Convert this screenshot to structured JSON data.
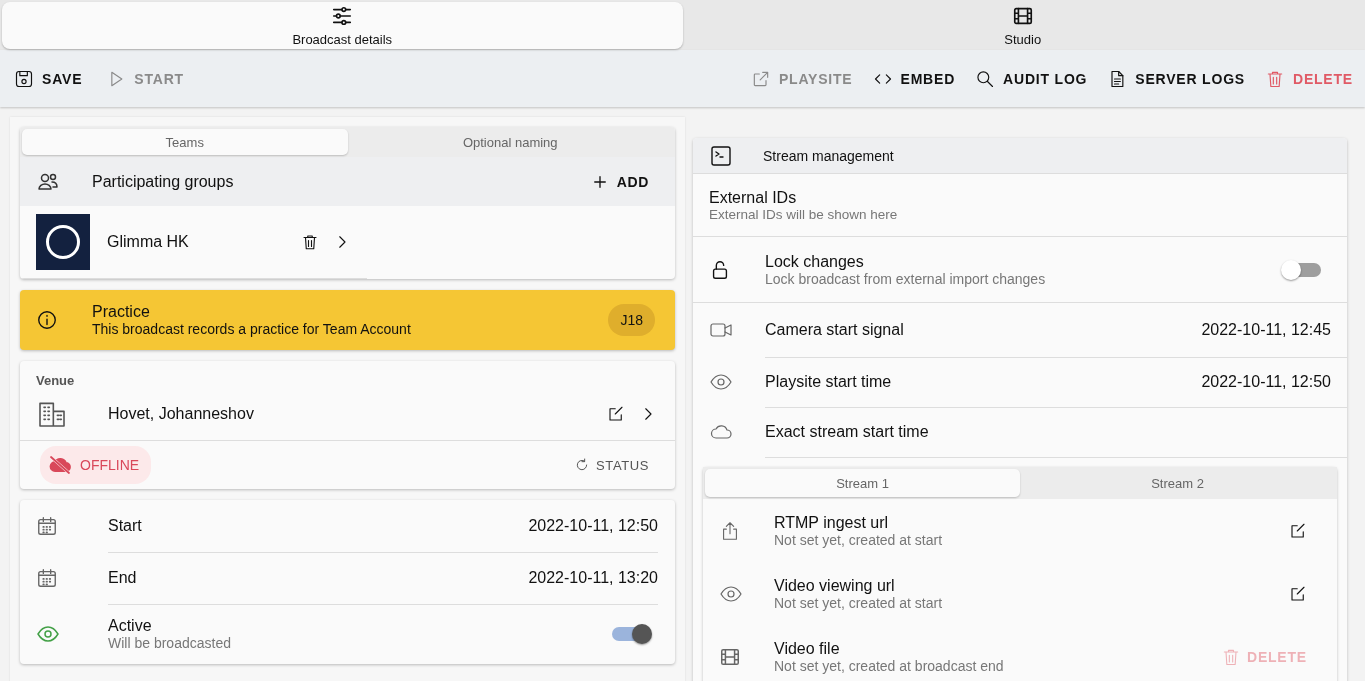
{
  "top_tabs": [
    {
      "label": "Broadcast details",
      "selected": true
    },
    {
      "label": "Studio",
      "selected": false
    }
  ],
  "toolbar": {
    "left": [
      {
        "label": "SAVE",
        "disabled": false
      },
      {
        "label": "START",
        "disabled": true
      }
    ],
    "right": [
      {
        "label": "PLAYSITE",
        "disabled": true,
        "kind": "normal"
      },
      {
        "label": "EMBED",
        "disabled": false,
        "kind": "normal"
      },
      {
        "label": "AUDIT LOG",
        "disabled": false,
        "kind": "normal"
      },
      {
        "label": "SERVER LOGS",
        "disabled": false,
        "kind": "normal"
      },
      {
        "label": "DELETE",
        "disabled": false,
        "kind": "danger"
      }
    ]
  },
  "teams_card": {
    "tabs": [
      {
        "label": "Teams",
        "selected": true
      },
      {
        "label": "Optional naming",
        "selected": false
      }
    ],
    "header": {
      "title": "Participating groups",
      "action": "ADD"
    },
    "groups": [
      {
        "name": "Glimma HK"
      }
    ]
  },
  "practice": {
    "title": "Practice",
    "text": "This broadcast records a practice for Team Account",
    "badge": "J18"
  },
  "venue": {
    "label": "Venue",
    "name": "Hovet, Johanneshov",
    "status": "OFFLINE",
    "status_action": "STATUS"
  },
  "schedule": [
    {
      "kind": "time",
      "label": "Start",
      "value": "2022-10-11, 12:50"
    },
    {
      "kind": "time",
      "label": "End",
      "value": "2022-10-11, 13:20"
    },
    {
      "kind": "toggle",
      "label": "Active",
      "sub": "Will be broadcasted",
      "on": true
    }
  ],
  "stream": {
    "title": "Stream management",
    "external_ids": {
      "title": "External IDs",
      "sub": "External IDs will be shown here"
    },
    "lock": {
      "label": "Lock changes",
      "sub": "Lock broadcast from external import changes",
      "on": false
    },
    "times": [
      {
        "label": "Camera start signal",
        "value": "2022-10-11, 12:45"
      },
      {
        "label": "Playsite start time",
        "value": "2022-10-11, 12:50"
      },
      {
        "label": "Exact stream start time"
      }
    ],
    "stream_tabs": [
      {
        "label": "Stream 1",
        "selected": true
      },
      {
        "label": "Stream 2",
        "selected": false
      }
    ],
    "urls": [
      {
        "kind": "edit",
        "label": "RTMP ingest url",
        "sub": "Not set yet, created at start"
      },
      {
        "kind": "edit",
        "label": "Video viewing url",
        "sub": "Not set yet, created at start"
      },
      {
        "kind": "delete",
        "label": "Video file",
        "sub": "Not set yet, created at broadcast end",
        "action": "DELETE",
        "disabled": true
      }
    ]
  }
}
